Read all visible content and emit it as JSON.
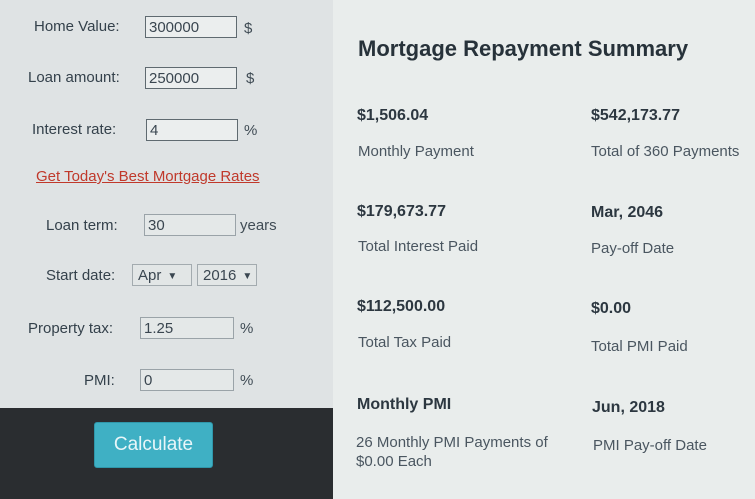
{
  "form": {
    "home_value": {
      "label": "Home Value:",
      "value": "300000",
      "unit": "$"
    },
    "loan_amount": {
      "label": "Loan amount:",
      "value": "250000",
      "unit": "$"
    },
    "interest_rate": {
      "label": "Interest rate:",
      "value": "4",
      "unit": "%"
    },
    "rates_link": "Get Today's Best Mortgage Rates",
    "loan_term": {
      "label": "Loan term:",
      "value": "30",
      "unit": "years"
    },
    "start_date": {
      "label": "Start date:",
      "month": "Apr",
      "year": "2016"
    },
    "property_tax": {
      "label": "Property tax:",
      "value": "1.25",
      "unit": "%"
    },
    "pmi": {
      "label": "PMI:",
      "value": "0",
      "unit": "%"
    },
    "calculate_label": "Calculate"
  },
  "summary": {
    "title": "Mortgage Repayment Summary",
    "items": [
      {
        "value": "$1,506.04",
        "caption": "Monthly Payment"
      },
      {
        "value": "$542,173.77",
        "caption": "Total of 360 Payments"
      },
      {
        "value": "$179,673.77",
        "caption": "Total Interest Paid"
      },
      {
        "value": "Mar, 2046",
        "caption": "Pay-off Date"
      },
      {
        "value": "$112,500.00",
        "caption": "Total Tax Paid"
      },
      {
        "value": "$0.00",
        "caption": "Total PMI Paid"
      },
      {
        "value": "Monthly PMI",
        "caption": "26 Monthly PMI Payments of $0.00 Each"
      },
      {
        "value": "Jun, 2018",
        "caption": "PMI Pay-off Date"
      }
    ]
  },
  "colors": {
    "link": "#c0392b",
    "button": "#3fb0c4",
    "bar": "#2a2d30"
  }
}
